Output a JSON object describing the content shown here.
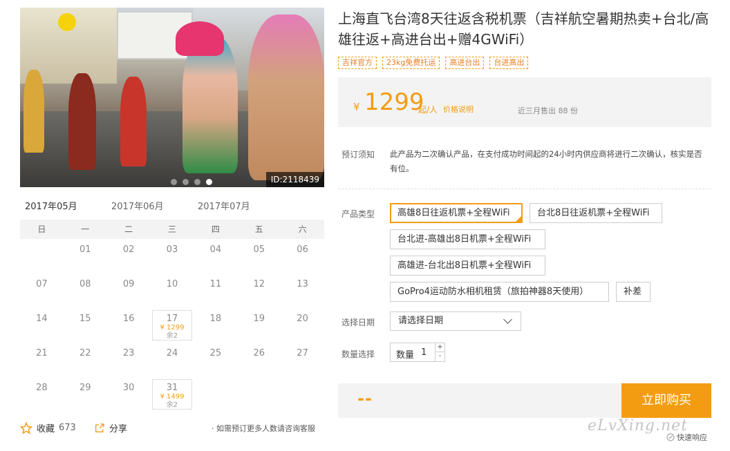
{
  "gallery": {
    "image_id": "ID:2118439",
    "slides": 4,
    "active_slide": 4
  },
  "calendar": {
    "months": [
      "2017年05月",
      "2017年06月",
      "2017年07月"
    ],
    "active_month": 0,
    "weekdays": [
      "日",
      "一",
      "二",
      "三",
      "四",
      "五",
      "六"
    ],
    "days": [
      {
        "d": ""
      },
      {
        "d": "01"
      },
      {
        "d": "02"
      },
      {
        "d": "03"
      },
      {
        "d": "04"
      },
      {
        "d": "05"
      },
      {
        "d": "06"
      },
      {
        "d": "07"
      },
      {
        "d": "08"
      },
      {
        "d": "09"
      },
      {
        "d": "10"
      },
      {
        "d": "11"
      },
      {
        "d": "12"
      },
      {
        "d": "13"
      },
      {
        "d": "14"
      },
      {
        "d": "15"
      },
      {
        "d": "16"
      },
      {
        "d": "17",
        "price": "¥ 1299",
        "stock": "余2"
      },
      {
        "d": "18"
      },
      {
        "d": "19"
      },
      {
        "d": "20"
      },
      {
        "d": "21"
      },
      {
        "d": "22"
      },
      {
        "d": "23"
      },
      {
        "d": "24"
      },
      {
        "d": "25"
      },
      {
        "d": "26"
      },
      {
        "d": "27"
      },
      {
        "d": "28"
      },
      {
        "d": "29"
      },
      {
        "d": "30"
      },
      {
        "d": "31",
        "price": "¥ 1499",
        "stock": "余2"
      }
    ]
  },
  "footer": {
    "favorite_label": "收藏",
    "favorite_count": "673",
    "share_label": "分享",
    "service_link": "· 如需预订更多人数请咨询客服"
  },
  "product": {
    "title": "上海直飞台湾8天往返含税机票（吉祥航空暑期热卖+台北/高雄往返+高进台出+赠4GWiFi）",
    "tags": [
      "吉祥官方",
      "23kg免费托运",
      "高进台出",
      "台进高出"
    ],
    "price": {
      "currency": "¥",
      "amount": "1299",
      "unit": "起/人",
      "explain": "价格说明",
      "sold": "近三月售出 88 份"
    },
    "notice_label": "预订须知",
    "notice_text": "此产品为二次确认产品，在支付成功时间起的24小时内供应商将进行二次确认，核实是否有位。",
    "type_label": "产品类型",
    "types": [
      "高雄8日往返机票+全程WiFi",
      "台北8日往返机票+全程WiFi",
      "台北进-高雄出8日机票+全程WiFi",
      "高雄进-台北出8日机票+全程WiFi",
      "GoPro4运动防水相机租赁（旅拍神器8天使用）",
      "补差"
    ],
    "selected_type": 0,
    "date_label": "选择日期",
    "date_placeholder": "请选择日期",
    "qty_label": "数量选择",
    "qty_inner_label": "数量",
    "qty_value": "1",
    "qty_plus": "+",
    "qty_minus": "-",
    "total": "--",
    "buy_label": "立即购买"
  },
  "watermark": "eLvXing.net",
  "quick_response": "快速响应",
  "colors": {
    "accent": "#f39c12",
    "panel_bg": "#f3f3f3"
  }
}
